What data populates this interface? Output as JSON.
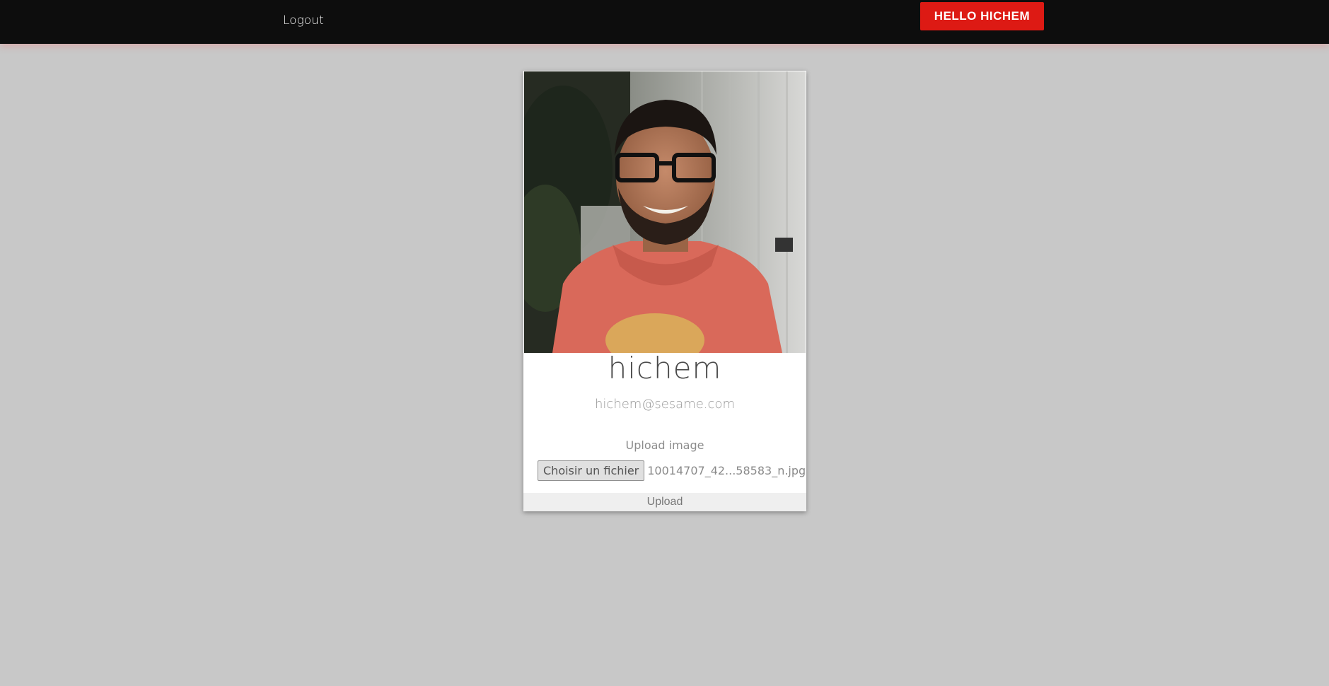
{
  "navbar": {
    "logout_label": "Logout",
    "hello_label": "HELLO HICHEM",
    "accent_color": "#dd1a14"
  },
  "profile": {
    "photo_alt": "profile photo",
    "name": "hichem",
    "email": "hichem@sesame.com",
    "upload_label": "Upload image",
    "choose_file_label": "Choisir un fichier",
    "selected_file": "10014707_42...58583_n.jpg",
    "upload_button_label": "Upload"
  }
}
